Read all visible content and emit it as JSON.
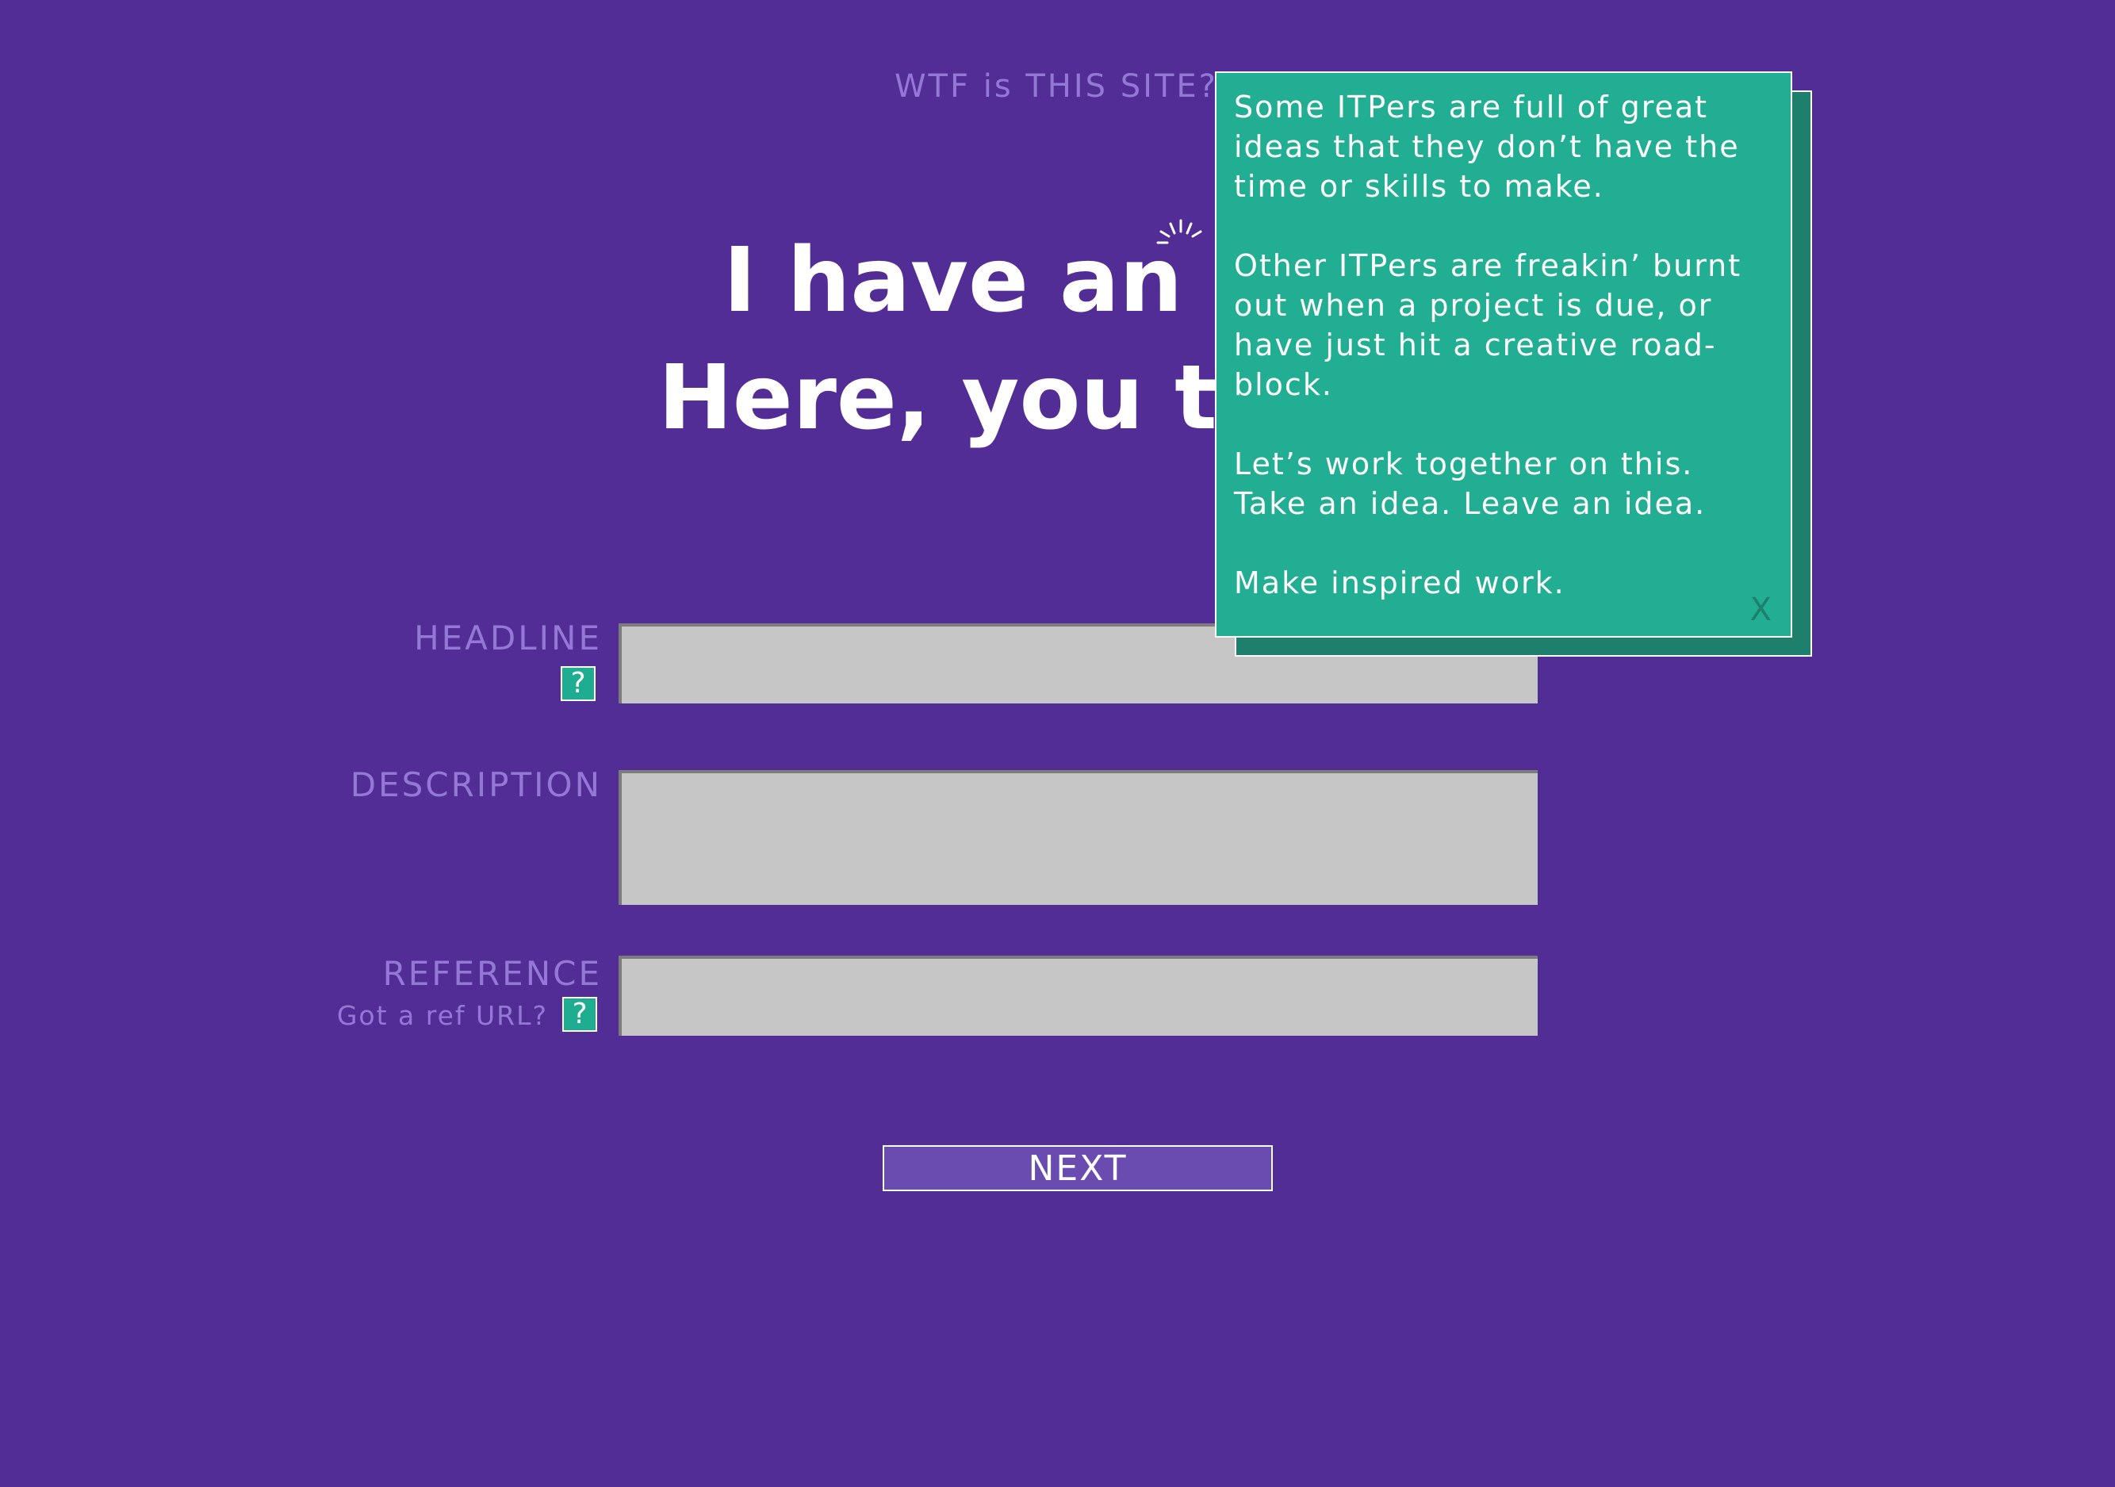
{
  "header": {
    "about_link": "WTF is THIS SITE?"
  },
  "hero": {
    "line1": "I have an idea.",
    "line2": "Here, you take it."
  },
  "form": {
    "headline_label": "HEADLINE",
    "description_label": "DESCRIPTION",
    "reference_label": "REFERENCE",
    "reference_sub": "Got a ref URL?",
    "help_glyph": "?",
    "headline_value": "",
    "description_value": "",
    "reference_value": ""
  },
  "next_button": "NEXT",
  "popup": {
    "paragraphs": [
      "Some ITPers are full of great ideas that they don’t have the time or skills to make.",
      "Other ITPers are freakin’ burnt out when a project is due, or have just hit a creative road-block.",
      "Let’s work together on this. Take an idea. Leave an idea.",
      "Make inspired work."
    ],
    "close_label": "X"
  },
  "colors": {
    "background": "#532d96",
    "accent_green": "#22ae93",
    "label_lavender": "#9478d6",
    "field_gray": "#c6c6c6"
  },
  "icons": [
    "lightbulb-spark-icon",
    "help-icon",
    "close-icon"
  ]
}
